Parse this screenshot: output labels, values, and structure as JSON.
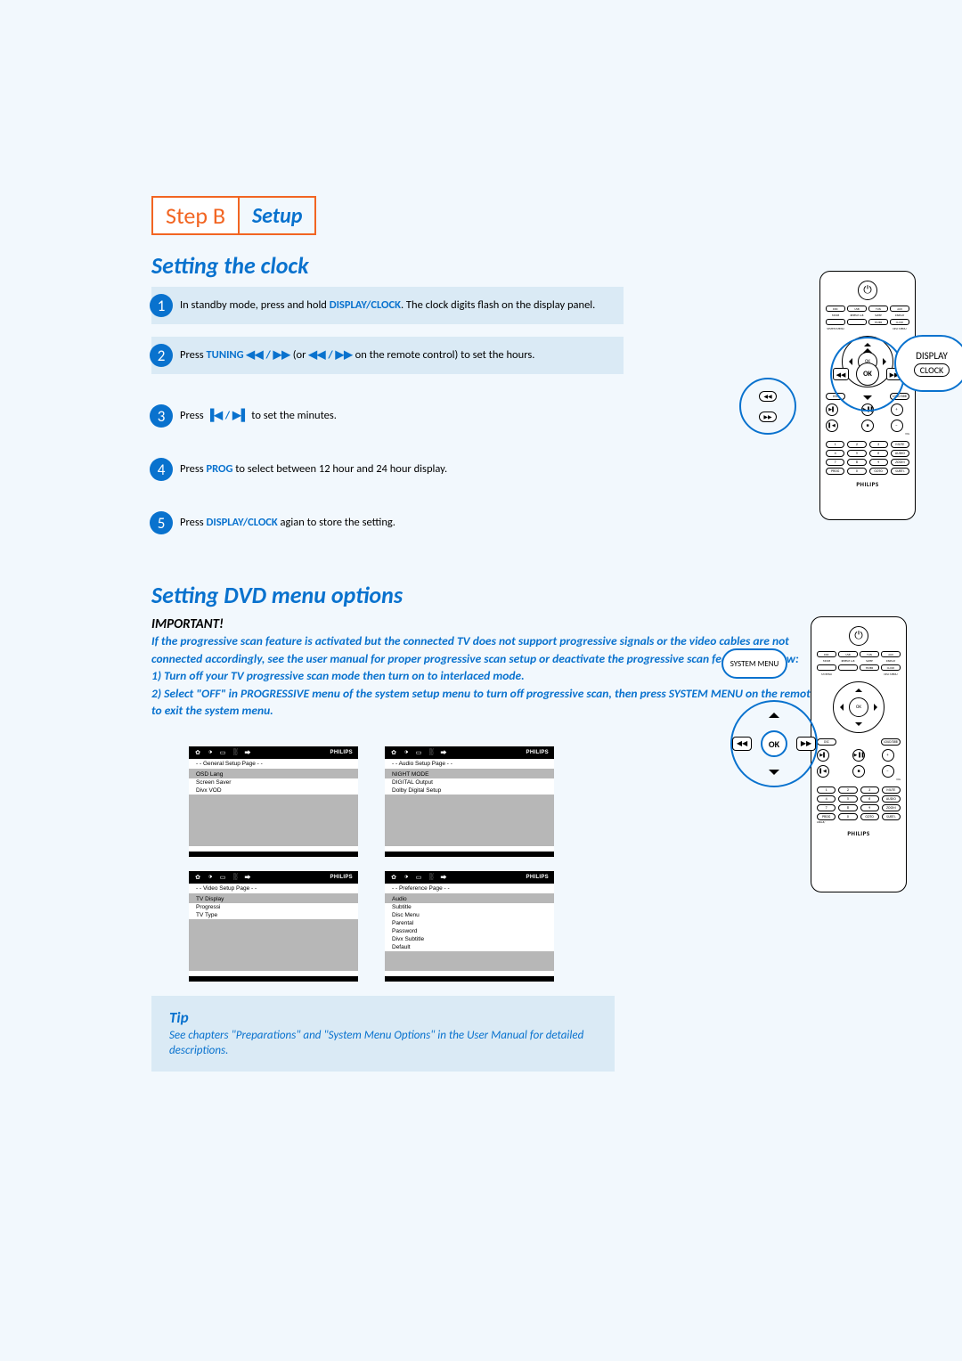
{
  "step_bar": {
    "step": "Step B",
    "setup": "Setup"
  },
  "section_clock_title": "Setting the clock",
  "steps": [
    {
      "n": "1",
      "pre": "In standby mode, press and hold ",
      "kw": "DISPLAY/CLOCK",
      "post": ". The clock digits flash on the display panel."
    },
    {
      "n": "2",
      "pre": "Press ",
      "kw": "TUNING ◀◀ / ▶▶",
      "mid": " (or ",
      "kw2": "◀◀ / ▶▶",
      "post": " on the remote control) to set the hours."
    },
    {
      "n": "3",
      "pre": "Press  ",
      "kw": "▐◀ / ▶▌",
      "post": "  to set the minutes."
    },
    {
      "n": "4",
      "pre": "Press ",
      "kw": "PROG",
      "post": " to select between 12 hour and 24 hour display."
    },
    {
      "n": "5",
      "pre": "Press ",
      "kw": "DISPLAY/CLOCK",
      "post": " agian to store the setting."
    }
  ],
  "display_callout": {
    "line1": "DISPLAY",
    "line2": "CLOCK"
  },
  "ok_label": "OK",
  "section_dvd_title": "Setting DVD menu options",
  "important_title": "IMPORTANT!",
  "important_body": "If the progressive scan feature is activated but the connected TV does not support progressive signals or the video cables are not connected accordingly, see the user manual for proper progressive scan setup or deactivate the progressive scan feature as below:\n1) Turn off your TV progressive scan mode then turn on to interlaced mode.\n2) Select \"OFF\" in PROGRESSIVE menu of the system setup menu to turn off progressive scan, then press SYSTEM MENU on the remote to exit the system menu.",
  "screens": {
    "brand": "PHILIPS",
    "general": {
      "title": "- -   General Setup Page   - -",
      "items": [
        "OSD Lang",
        "Screen Saver",
        "Divx VOD"
      ]
    },
    "audio": {
      "title": "- -   Audio Setup Page   - -",
      "items": [
        "NIGHT MODE",
        "DIGITAL Output",
        "Dolby Digital Setup"
      ]
    },
    "video": {
      "title": "- -   Video Setup Page   - -",
      "items": [
        "TV Display",
        "Progressi",
        "TV Type"
      ]
    },
    "preference": {
      "title": "- -   Preference Page   - -",
      "items": [
        "Audio",
        "Subtitle",
        "Disc Menu",
        "Parental",
        "Password",
        "Divx Subtitle",
        "Default"
      ]
    }
  },
  "tip": {
    "title": "Tip",
    "body": "See chapters \"Preparations\" and \"System Menu Options\" in the User Manual for detailed descriptions."
  },
  "remote": {
    "brand": "PHILIPS",
    "row1": [
      "DISC",
      "USB",
      "TUN",
      "AUX"
    ],
    "row2_labels": [
      "MODE",
      "REPEAT A-B",
      "SLEEP",
      "DISPLAY"
    ],
    "row2": [
      "",
      "",
      "TIMER",
      "CLOCK"
    ],
    "row3_labels": [
      "SYSTEM MENU",
      "",
      "",
      "DISC MENU"
    ],
    "below": [
      "DSC",
      "",
      "LOUD/DBB"
    ],
    "playback_icons": [
      "▶▌",
      "▐▐▶",
      "+",
      "▌◀",
      "■",
      "−"
    ],
    "numpad": [
      "1",
      "2",
      "3",
      "MUTE",
      "4",
      "5",
      "6",
      "AUDIO",
      "7",
      "8",
      "9",
      "ZOOM",
      "PROG",
      "0",
      "GOTO",
      "SUBTI."
    ],
    "extra_labels": [
      "ANGLE/"
    ],
    "vol": "VOL"
  },
  "system_menu_label": "SYSTEM MENU",
  "ok_big": "OK"
}
